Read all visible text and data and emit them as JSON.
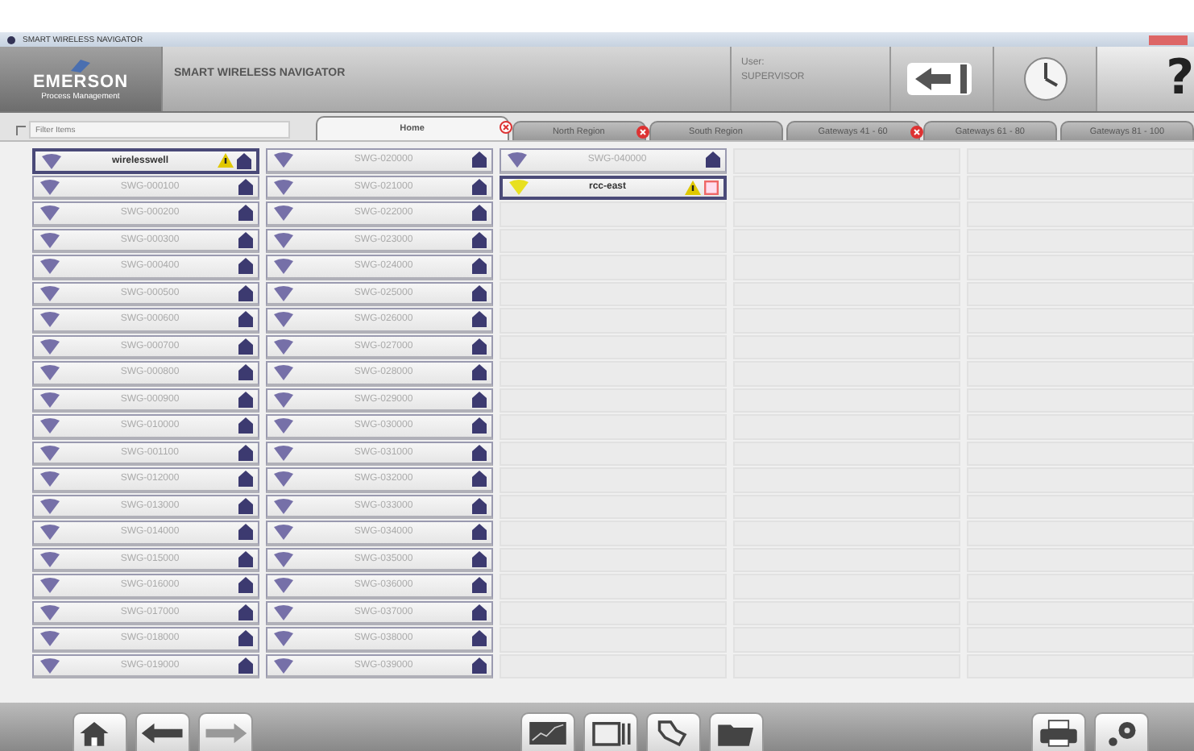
{
  "window": {
    "title": "SMART WIRELESS NAVIGATOR"
  },
  "header": {
    "logo": {
      "name": "EMERSON",
      "tagline": "Process Management"
    },
    "app_title": "SMART WIRELESS NAVIGATOR",
    "user_label": "User:",
    "user": "SUPERVISOR",
    "help": "?"
  },
  "filter": {
    "checked": false,
    "placeholder": "Filter Items"
  },
  "tabs": [
    {
      "label": "Home",
      "selected": true,
      "closable": true
    },
    {
      "label": "North Region",
      "selected": false,
      "closable": true
    },
    {
      "label": "South Region",
      "selected": false,
      "closable": false
    },
    {
      "label": "Gateways 41 - 60",
      "selected": false,
      "closable": true
    },
    {
      "label": "Gateways 61 - 80",
      "selected": false,
      "closable": false
    },
    {
      "label": "Gateways 81 - 100",
      "selected": false,
      "closable": false
    }
  ],
  "columns": [
    {
      "items": [
        {
          "label": "wirelesswell",
          "selected": true,
          "alert": true,
          "kind": "gateway"
        },
        {
          "label": "SWG-000100",
          "selected": false,
          "alert": false,
          "kind": "gateway"
        },
        {
          "label": "SWG-000200",
          "selected": false,
          "alert": false,
          "kind": "gateway"
        },
        {
          "label": "SWG-000300",
          "selected": false,
          "alert": false,
          "kind": "gateway"
        },
        {
          "label": "SWG-000400",
          "selected": false,
          "alert": false,
          "kind": "gateway"
        },
        {
          "label": "SWG-000500",
          "selected": false,
          "alert": false,
          "kind": "gateway"
        },
        {
          "label": "SWG-000600",
          "selected": false,
          "alert": false,
          "kind": "gateway"
        },
        {
          "label": "SWG-000700",
          "selected": false,
          "alert": false,
          "kind": "gateway"
        },
        {
          "label": "SWG-000800",
          "selected": false,
          "alert": false,
          "kind": "gateway"
        },
        {
          "label": "SWG-000900",
          "selected": false,
          "alert": false,
          "kind": "gateway"
        },
        {
          "label": "SWG-010000",
          "selected": false,
          "alert": false,
          "kind": "gateway"
        },
        {
          "label": "SWG-001100",
          "selected": false,
          "alert": false,
          "kind": "gateway"
        },
        {
          "label": "SWG-012000",
          "selected": false,
          "alert": false,
          "kind": "gateway"
        },
        {
          "label": "SWG-013000",
          "selected": false,
          "alert": false,
          "kind": "gateway"
        },
        {
          "label": "SWG-014000",
          "selected": false,
          "alert": false,
          "kind": "gateway"
        },
        {
          "label": "SWG-015000",
          "selected": false,
          "alert": false,
          "kind": "gateway"
        },
        {
          "label": "SWG-016000",
          "selected": false,
          "alert": false,
          "kind": "gateway"
        },
        {
          "label": "SWG-017000",
          "selected": false,
          "alert": false,
          "kind": "gateway"
        },
        {
          "label": "SWG-018000",
          "selected": false,
          "alert": false,
          "kind": "gateway"
        },
        {
          "label": "SWG-019000",
          "selected": false,
          "alert": false,
          "kind": "gateway"
        }
      ]
    },
    {
      "items": [
        {
          "label": "SWG-020000",
          "selected": false,
          "alert": false,
          "kind": "gateway"
        },
        {
          "label": "SWG-021000",
          "selected": false,
          "alert": false,
          "kind": "gateway"
        },
        {
          "label": "SWG-022000",
          "selected": false,
          "alert": false,
          "kind": "gateway"
        },
        {
          "label": "SWG-023000",
          "selected": false,
          "alert": false,
          "kind": "gateway"
        },
        {
          "label": "SWG-024000",
          "selected": false,
          "alert": false,
          "kind": "gateway"
        },
        {
          "label": "SWG-025000",
          "selected": false,
          "alert": false,
          "kind": "gateway"
        },
        {
          "label": "SWG-026000",
          "selected": false,
          "alert": false,
          "kind": "gateway"
        },
        {
          "label": "SWG-027000",
          "selected": false,
          "alert": false,
          "kind": "gateway"
        },
        {
          "label": "SWG-028000",
          "selected": false,
          "alert": false,
          "kind": "gateway"
        },
        {
          "label": "SWG-029000",
          "selected": false,
          "alert": false,
          "kind": "gateway"
        },
        {
          "label": "SWG-030000",
          "selected": false,
          "alert": false,
          "kind": "gateway"
        },
        {
          "label": "SWG-031000",
          "selected": false,
          "alert": false,
          "kind": "gateway"
        },
        {
          "label": "SWG-032000",
          "selected": false,
          "alert": false,
          "kind": "gateway"
        },
        {
          "label": "SWG-033000",
          "selected": false,
          "alert": false,
          "kind": "gateway"
        },
        {
          "label": "SWG-034000",
          "selected": false,
          "alert": false,
          "kind": "gateway"
        },
        {
          "label": "SWG-035000",
          "selected": false,
          "alert": false,
          "kind": "gateway"
        },
        {
          "label": "SWG-036000",
          "selected": false,
          "alert": false,
          "kind": "gateway"
        },
        {
          "label": "SWG-037000",
          "selected": false,
          "alert": false,
          "kind": "gateway"
        },
        {
          "label": "SWG-038000",
          "selected": false,
          "alert": false,
          "kind": "gateway"
        },
        {
          "label": "SWG-039000",
          "selected": false,
          "alert": false,
          "kind": "gateway"
        }
      ]
    },
    {
      "items": [
        {
          "label": "SWG-040000",
          "selected": false,
          "alert": false,
          "kind": "gateway"
        },
        {
          "label": "rcc-east",
          "selected": true,
          "alert": true,
          "kind": "fault"
        }
      ]
    }
  ],
  "toolbar": [
    {
      "kind": "home",
      "disabled": false
    },
    {
      "kind": "back",
      "disabled": false
    },
    {
      "kind": "forward",
      "disabled": true
    },
    {
      "kind": "gap"
    },
    {
      "kind": "trend",
      "disabled": false
    },
    {
      "kind": "windows",
      "disabled": false
    },
    {
      "kind": "map",
      "disabled": false
    },
    {
      "kind": "folder",
      "disabled": false
    },
    {
      "kind": "gap"
    },
    {
      "kind": "print",
      "disabled": false
    },
    {
      "kind": "settings",
      "disabled": false
    }
  ]
}
